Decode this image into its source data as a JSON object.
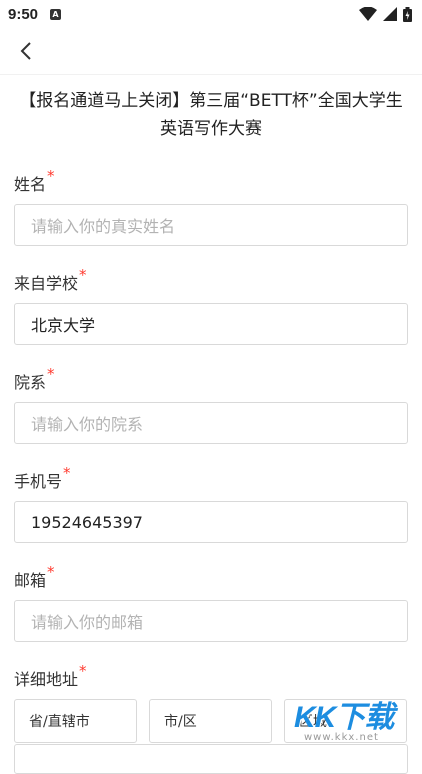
{
  "status_bar": {
    "time": "9:50",
    "notification_icon": "A"
  },
  "title": {
    "line1": "【报名通道马上关闭】第三届“BETT杯”全国大学生",
    "line2": "英语写作大赛"
  },
  "form": {
    "name": {
      "label": "姓名",
      "required": "*",
      "placeholder": "请输入你的真实姓名"
    },
    "school": {
      "label": "来自学校",
      "required": "*",
      "value": "北京大学"
    },
    "department": {
      "label": "院系",
      "required": "*",
      "placeholder": "请输入你的院系"
    },
    "phone": {
      "label": "手机号",
      "required": "*",
      "value": "19524645397"
    },
    "email": {
      "label": "邮箱",
      "required": "*",
      "placeholder": "请输入你的邮箱"
    },
    "address": {
      "label": "详细地址",
      "required": "*",
      "province": "省/直辖市",
      "city": "市/区",
      "district": "区域"
    }
  },
  "watermark": {
    "text": "KK下载",
    "url": "www.kkx.net"
  },
  "colors": {
    "required": "#ff3b30",
    "placeholder": "#b3b3b3",
    "border": "#d9d9d9"
  }
}
